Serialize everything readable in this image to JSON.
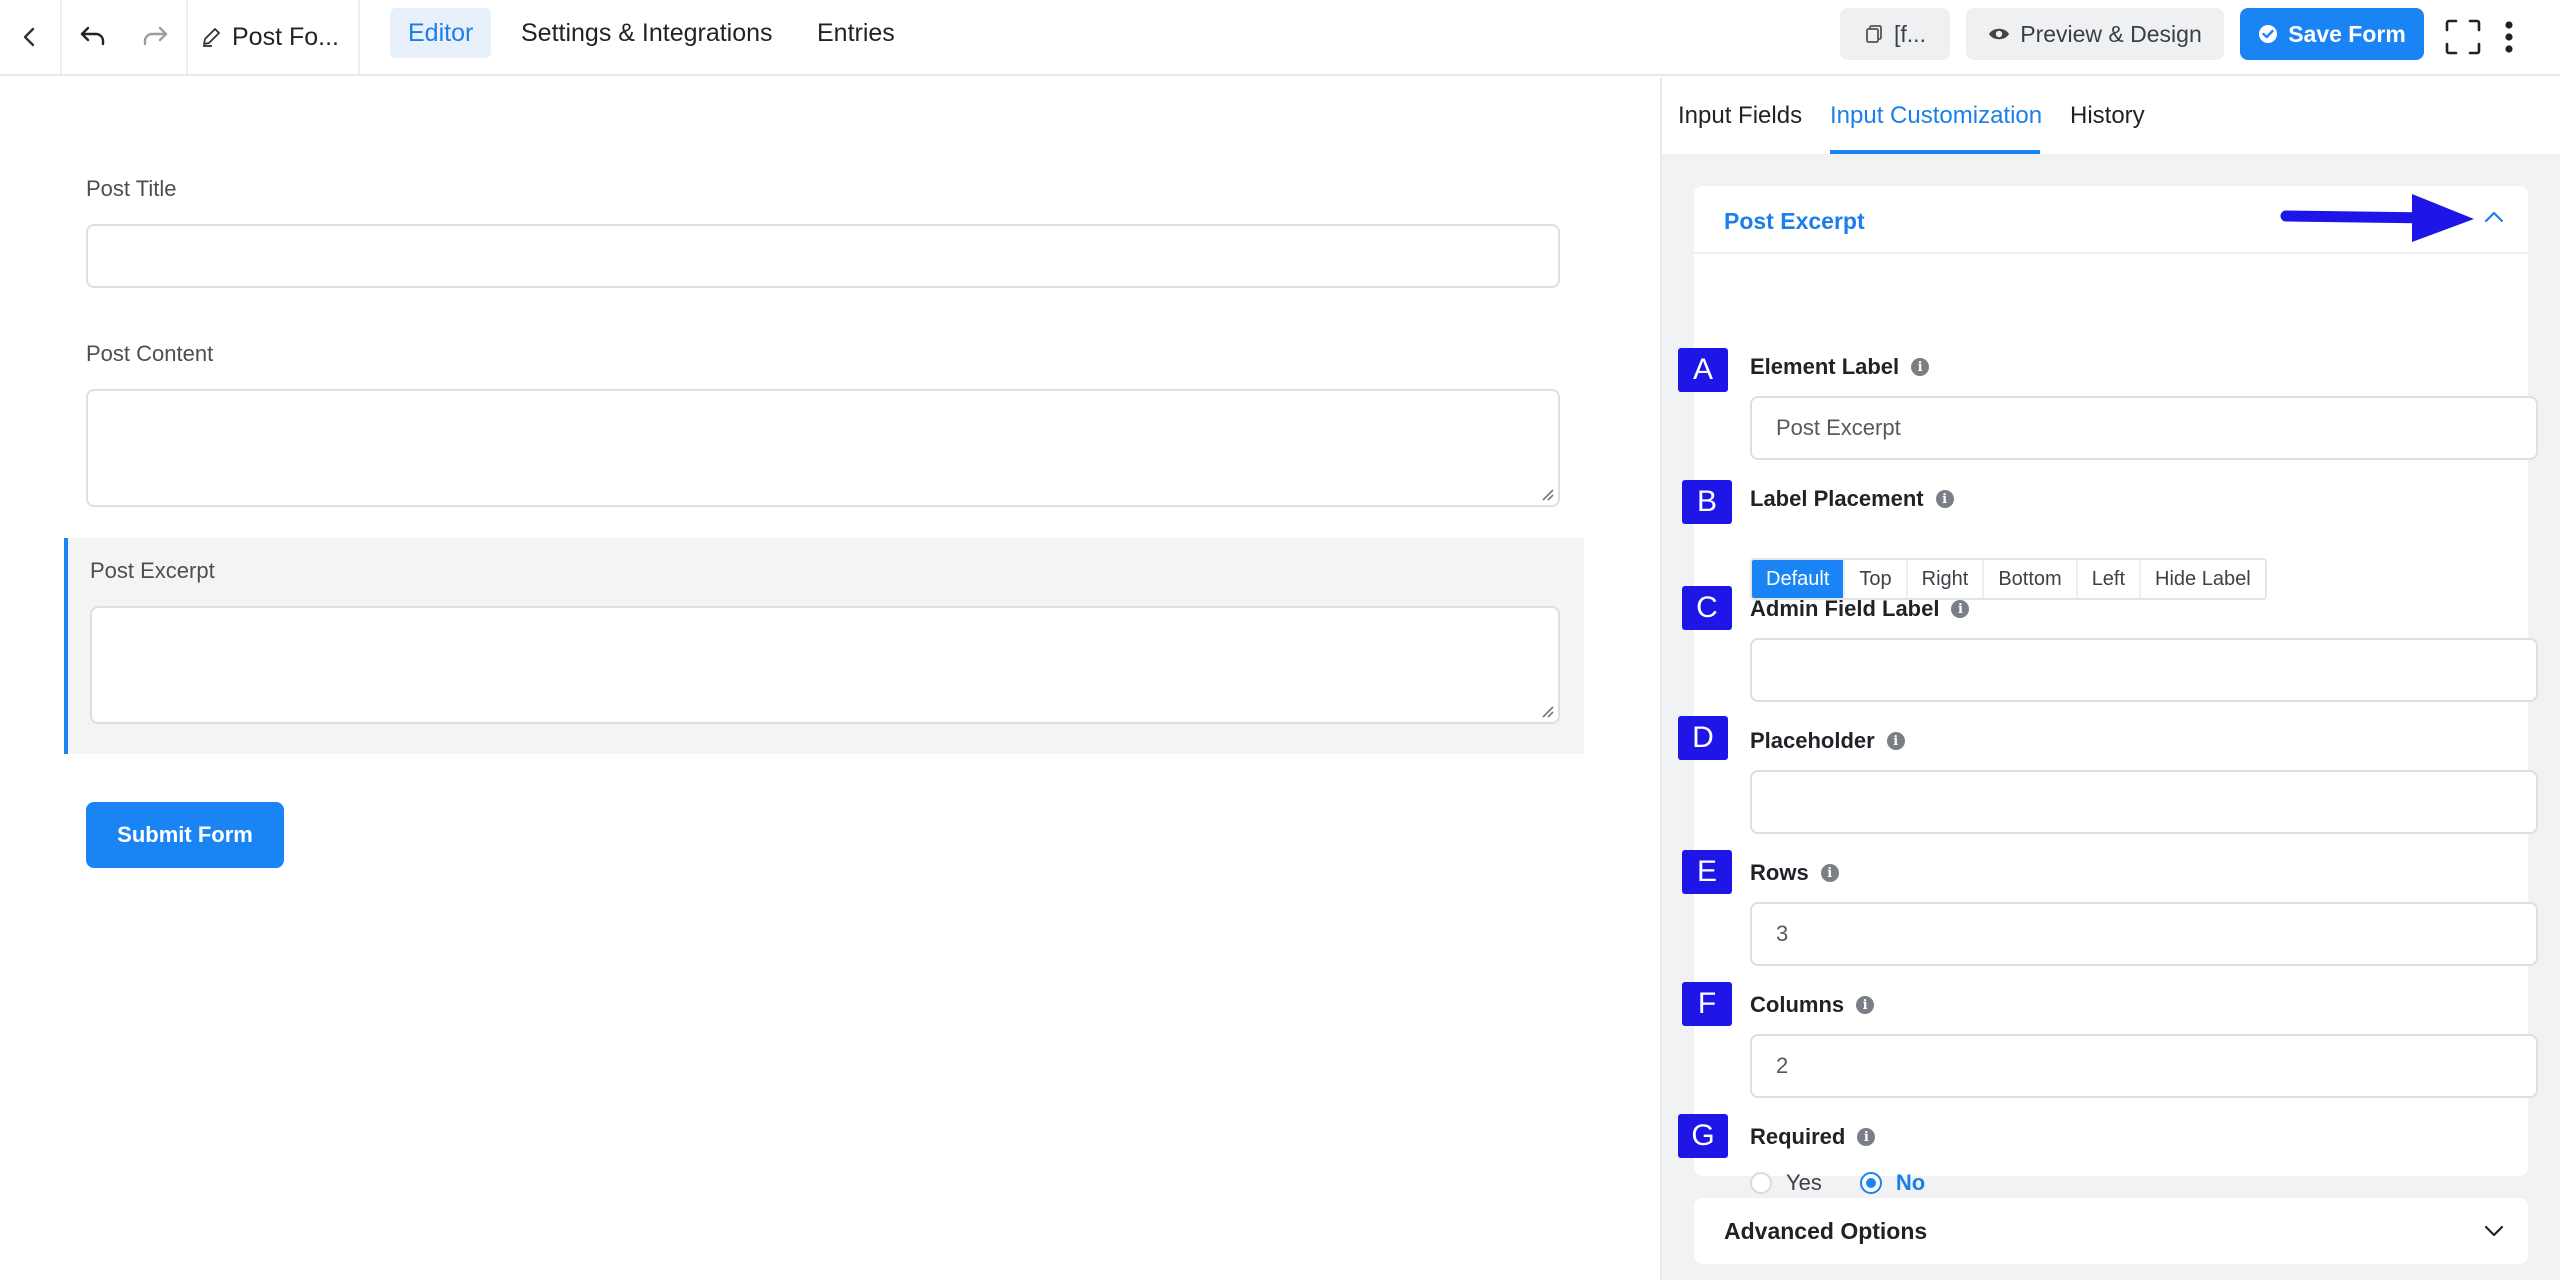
{
  "header": {
    "form_title": "Post Fo...",
    "tabs": [
      {
        "label": "Editor",
        "active": true
      },
      {
        "label": "Settings & Integrations",
        "active": false
      },
      {
        "label": "Entries",
        "active": false
      }
    ],
    "shortcode_label": "[f...",
    "preview_label": "Preview & Design",
    "save_label": "Save Form"
  },
  "form": {
    "fields": [
      {
        "label": "Post Title"
      },
      {
        "label": "Post Content"
      },
      {
        "label": "Post Excerpt"
      }
    ],
    "submit_label": "Submit Form"
  },
  "panel": {
    "tabs": [
      {
        "label": "Input Fields",
        "active": false
      },
      {
        "label": "Input Customization",
        "active": true
      },
      {
        "label": "History",
        "active": false
      }
    ],
    "section_title": "Post Excerpt",
    "options": {
      "element_label": {
        "badge": "A",
        "label": "Element Label",
        "value": "Post Excerpt"
      },
      "label_placement": {
        "badge": "B",
        "label": "Label Placement",
        "choices": [
          "Default",
          "Top",
          "Right",
          "Bottom",
          "Left",
          "Hide Label"
        ],
        "selected": "Default"
      },
      "admin_field_label": {
        "badge": "C",
        "label": "Admin Field Label",
        "value": ""
      },
      "placeholder": {
        "badge": "D",
        "label": "Placeholder",
        "value": ""
      },
      "rows": {
        "badge": "E",
        "label": "Rows",
        "value": "3"
      },
      "columns": {
        "badge": "F",
        "label": "Columns",
        "value": "2"
      },
      "required": {
        "badge": "G",
        "label": "Required",
        "yes": "Yes",
        "no": "No",
        "selected": "No"
      }
    },
    "advanced_title": "Advanced Options"
  },
  "colors": {
    "accent": "#1a84f5",
    "badge": "#1e16e6",
    "arrow": "#1e16e6"
  }
}
